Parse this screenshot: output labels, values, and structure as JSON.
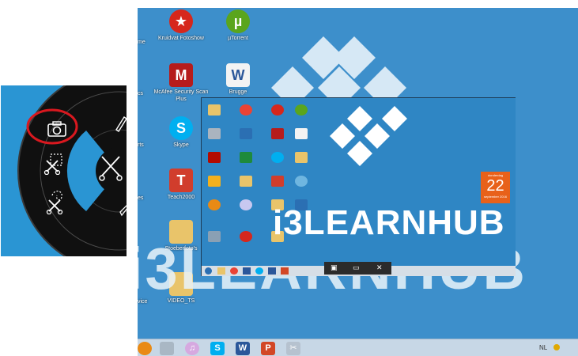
{
  "radial_menu": {
    "tools": [
      {
        "name": "camera-icon",
        "selected": true
      },
      {
        "name": "rectangle-snip-icon"
      },
      {
        "name": "freeform-snip-icon"
      },
      {
        "name": "scissors-icon"
      },
      {
        "name": "pen-icon"
      }
    ],
    "highlight_color": "#d9181f",
    "center_color": "#2a95d3"
  },
  "desktop": {
    "edge_labels": [
      "me",
      "cs",
      "rts",
      "es",
      "vice"
    ],
    "icons": [
      {
        "label": "Kruidvat Fotoshow",
        "icon": "star-icon",
        "color": "#d6271c"
      },
      {
        "label": "µTorrent",
        "icon": "utorrent-icon",
        "color": "#5aa51d"
      },
      {
        "label": "McAfee Security Scan Plus",
        "icon": "mcafee-shield-icon",
        "color": "#b61c1c"
      },
      {
        "label": "Brugge",
        "icon": "word-document-icon",
        "color": "#2b579a"
      },
      {
        "label": "Skype",
        "icon": "skype-icon",
        "color": "#00aff0"
      },
      {
        "label": "Teach2000",
        "icon": "teach2000-icon",
        "color": "#d13d2c"
      },
      {
        "label": "Stoeberfoto's",
        "icon": "folder-icon",
        "color": "#e9c46a"
      },
      {
        "label": "VIDEO_TS",
        "icon": "folder-icon",
        "color": "#e9c46a"
      }
    ],
    "watermark": "i3LEARNHUB"
  },
  "inner_screen": {
    "brand": "i3LEARNHUB",
    "calendar": {
      "weekday": "donderdag",
      "day": "22",
      "month": "september 2016"
    },
    "snip_toolbar": {
      "items": [
        "▣",
        "▭",
        "✕"
      ]
    }
  },
  "taskbar": {
    "items": [
      "start-orb-icon",
      "explorer-icon",
      "itunes-icon",
      "skype-icon",
      "word-icon",
      "powerpoint-icon",
      "snipping-tool-icon"
    ],
    "language": "NL"
  }
}
